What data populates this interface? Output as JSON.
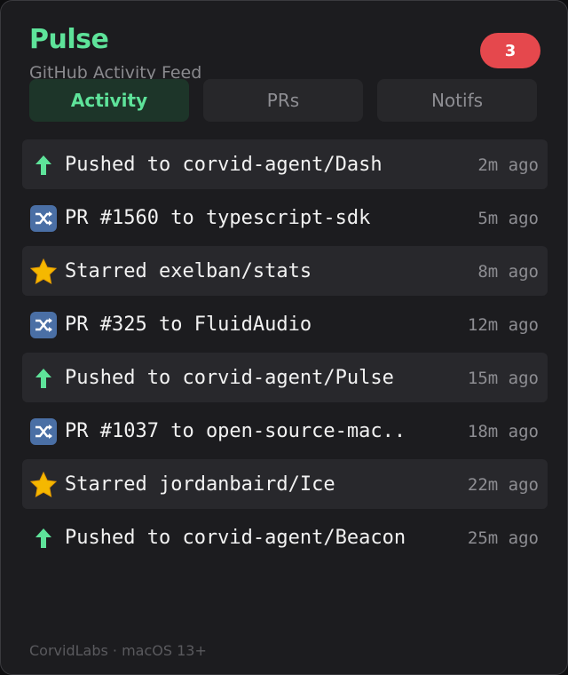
{
  "app": {
    "title": "Pulse",
    "subtitle": "GitHub Activity Feed",
    "badge_count": "3"
  },
  "tabs": [
    {
      "label": "Activity",
      "active": true
    },
    {
      "label": "PRs",
      "active": false
    },
    {
      "label": "Notifs",
      "active": false
    }
  ],
  "feed": [
    {
      "icon": "arrow-up-icon",
      "text": "Pushed to corvid-agent/Dash",
      "time": "2m ago"
    },
    {
      "icon": "shuffle-icon",
      "text": "PR #1560 to typescript-sdk",
      "time": "5m ago"
    },
    {
      "icon": "star-icon",
      "text": "Starred exelban/stats",
      "time": "8m ago"
    },
    {
      "icon": "shuffle-icon",
      "text": "PR #325 to FluidAudio",
      "time": "12m ago"
    },
    {
      "icon": "arrow-up-icon",
      "text": "Pushed to corvid-agent/Pulse",
      "time": "15m ago"
    },
    {
      "icon": "shuffle-icon",
      "text": "PR #1037 to open-source-mac..",
      "time": "18m ago"
    },
    {
      "icon": "star-icon",
      "text": "Starred jordanbaird/Ice",
      "time": "22m ago"
    },
    {
      "icon": "arrow-up-icon",
      "text": "Pushed to corvid-agent/Beacon",
      "time": "25m ago"
    }
  ],
  "footer": "CorvidLabs · macOS 13+",
  "colors": {
    "accent": "#5ee39a",
    "badge": "#e5484d",
    "background": "#1c1c1f",
    "row_shade": "#28282c",
    "shuffle_icon": "#4a6fa5",
    "star_icon": "#f5b800"
  }
}
